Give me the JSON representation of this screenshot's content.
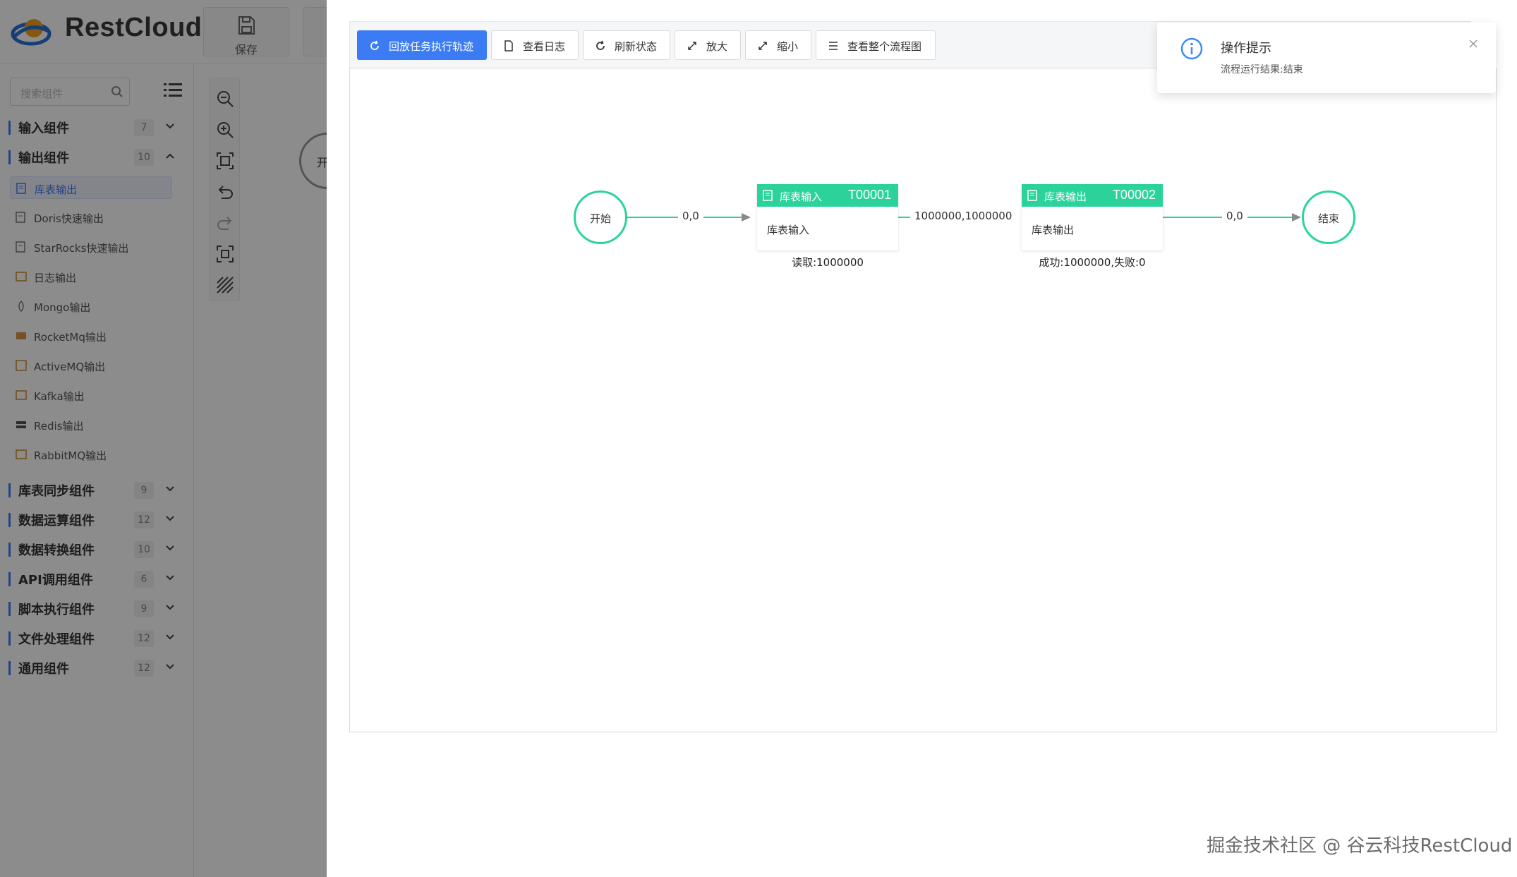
{
  "app": {
    "brand": "RestCloud",
    "save_label": "保存"
  },
  "sidebar": {
    "search_placeholder": "搜索组件",
    "categories": [
      {
        "name": "输入组件",
        "count": "7"
      },
      {
        "name": "输出组件",
        "count": "10"
      },
      {
        "name": "库表同步组件",
        "count": "9"
      },
      {
        "name": "数据运算组件",
        "count": "12"
      },
      {
        "name": "数据转换组件",
        "count": "10"
      },
      {
        "name": "API调用组件",
        "count": "6"
      },
      {
        "name": "脚本执行组件",
        "count": "9"
      },
      {
        "name": "文件处理组件",
        "count": "12"
      },
      {
        "name": "通用组件",
        "count": "12"
      }
    ],
    "output_items": [
      "库表输出",
      "Doris快速输出",
      "StarRocks快速输出",
      "日志输出",
      "Mongo输出",
      "RocketMq输出",
      "ActiveMQ输出",
      "Kafka输出",
      "Redis输出",
      "RabbitMQ输出"
    ],
    "canvas_node_label": "开"
  },
  "toolbar": {
    "replay": "回放任务执行轨迹",
    "view_log": "查看日志",
    "refresh": "刷新状态",
    "zoom_in": "放大",
    "zoom_out": "缩小",
    "view_all": "查看整个流程图"
  },
  "flow": {
    "start_label": "开始",
    "end_label": "结束",
    "node1": {
      "title": "库表输入",
      "code": "T00001",
      "body": "库表输入",
      "stat": "读取:1000000"
    },
    "node2": {
      "title": "库表输出",
      "code": "T00002",
      "body": "库表输出",
      "stat": "成功:1000000,失败:0"
    },
    "edge1": "0,0",
    "edge2": "1000000,1000000",
    "edge3": "0,0",
    "accent_color": "#2bd39a"
  },
  "notification": {
    "title": "操作提示",
    "message": "流程运行结果:结束"
  },
  "watermark": "掘金技术社区 @ 谷云科技RestCloud"
}
